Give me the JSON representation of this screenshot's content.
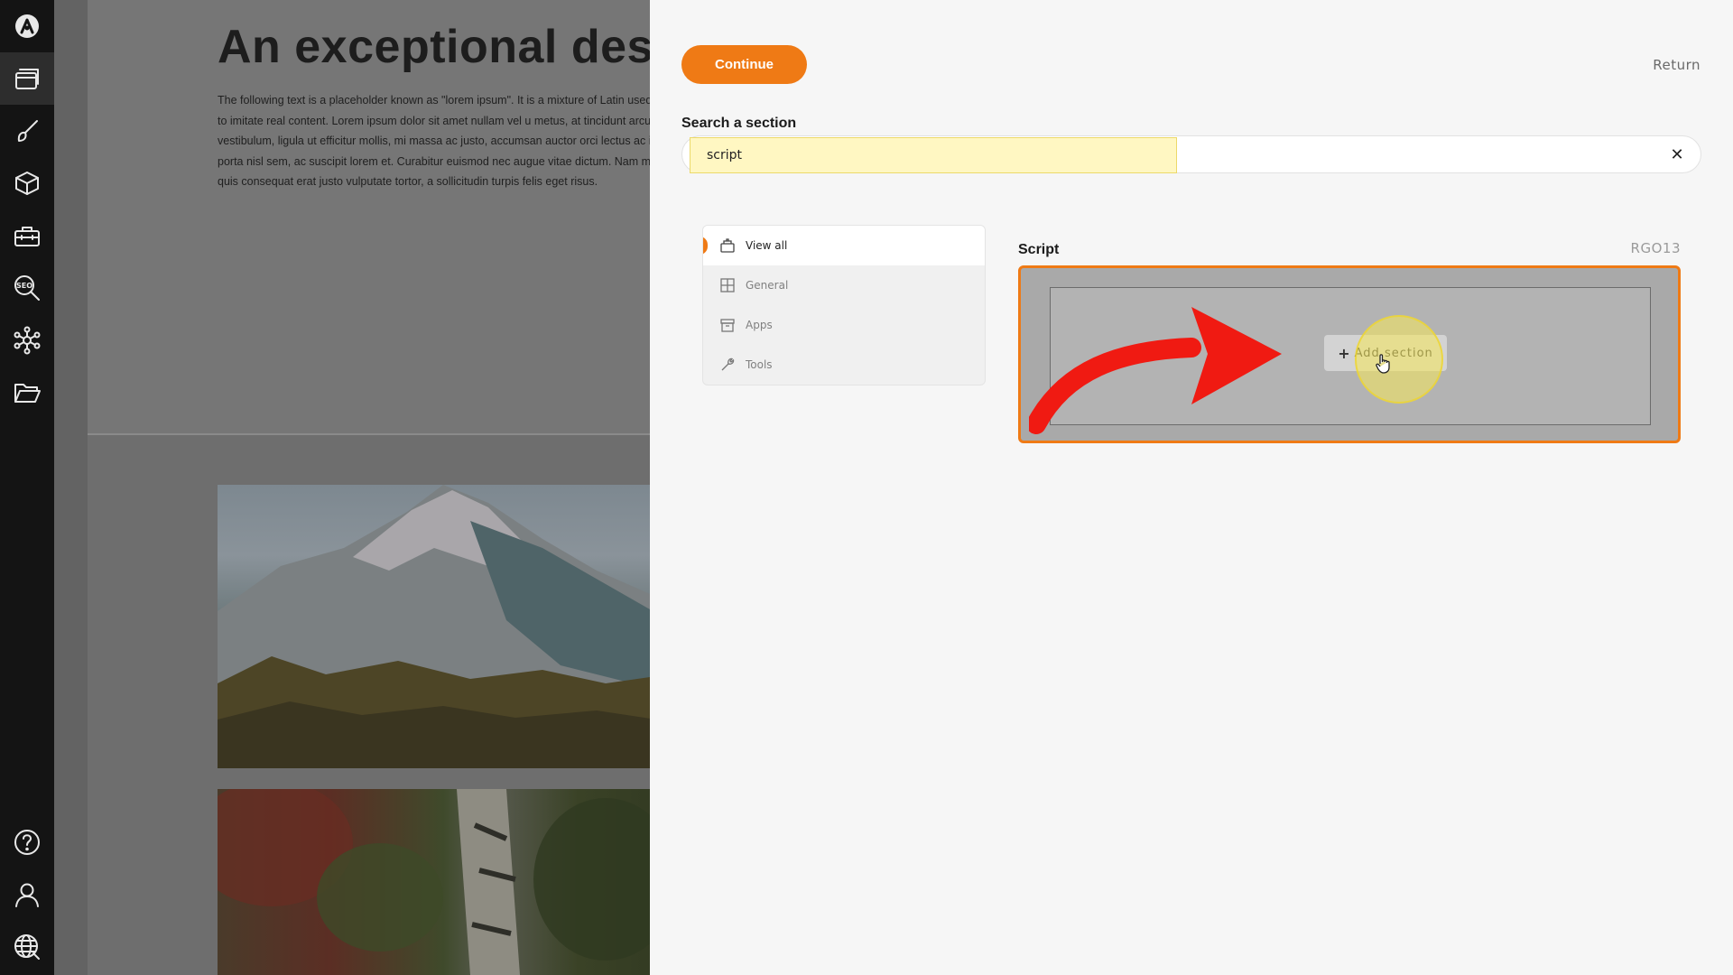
{
  "sidebar": {
    "items": [
      {
        "icon": "logo-icon"
      },
      {
        "icon": "pages-icon",
        "active": true
      },
      {
        "icon": "brush-icon"
      },
      {
        "icon": "box-icon"
      },
      {
        "icon": "toolbox-icon"
      },
      {
        "icon": "seo-icon",
        "label": "SEO"
      },
      {
        "icon": "network-icon"
      },
      {
        "icon": "folder-icon"
      },
      {
        "icon": "help-icon"
      },
      {
        "icon": "user-icon"
      },
      {
        "icon": "globe-icon"
      }
    ]
  },
  "preview": {
    "heading": "An exceptional desig",
    "body": "The following text is a placeholder known as \"lorem ipsum\". It is a mixture of Latin used by designers to imitate real content. Lorem ipsum dolor sit amet nullam vel u metus, at tincidunt arcu. Morbi vestibulum, ligula ut efficitur mollis, mi massa ac justo, accumsan auctor orci lectus ac ipsum. Proin porta nisl sem, ac suscipit lorem et. Curabitur euismod nec augue vitae dictum. Nam mattis, massa quis consequat erat justo vulputate tortor, a sollicitudin turpis felis eget risus."
  },
  "panel": {
    "continue_label": "Continue",
    "return_label": "Return",
    "search_label": "Search a section",
    "search_value": "script",
    "clear_icon": "close-icon",
    "categories": [
      {
        "label": "View all",
        "icon": "view-all-icon",
        "active": true
      },
      {
        "label": "General",
        "icon": "grid-icon",
        "active": false
      },
      {
        "label": "Apps",
        "icon": "archive-icon",
        "active": false
      },
      {
        "label": "Tools",
        "icon": "wrench-icon",
        "active": false
      }
    ],
    "result": {
      "title": "Script",
      "code": "RGO13",
      "add_label": "Add section"
    }
  },
  "colors": {
    "accent": "#ef7a15",
    "rail": "#141414",
    "panel_bg": "#f6f6f6",
    "highlight": "#fff7c2",
    "annotation_arrow": "#f01a12"
  }
}
